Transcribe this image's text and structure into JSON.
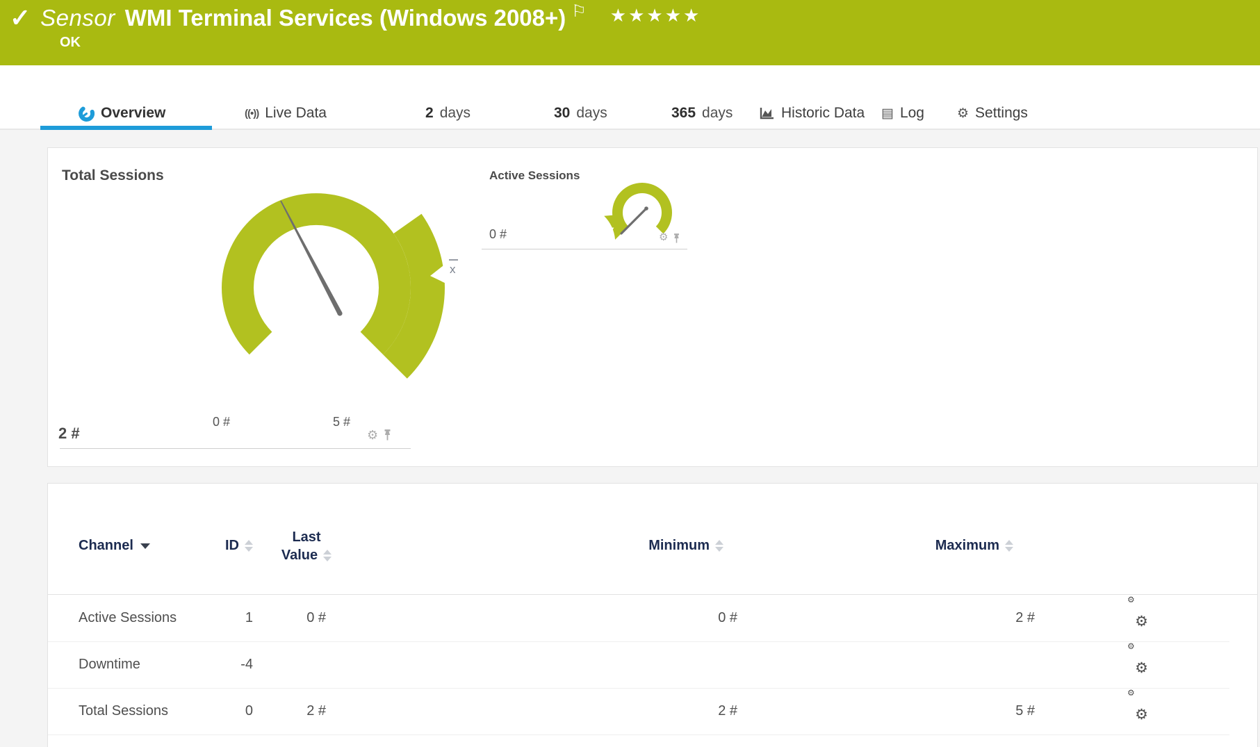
{
  "header": {
    "kind": "Sensor",
    "title": "WMI Terminal Services (Windows 2008+)",
    "status": "OK",
    "check_icon": "✓",
    "flag_icon": "⚐",
    "stars": "★★★★★",
    "bar_color": "#a9ba11"
  },
  "tabs": [
    {
      "label": "Overview",
      "icon": "gauge-icon",
      "active": true
    },
    {
      "label": "Live Data",
      "icon": "live-data-icon"
    },
    {
      "num": "2",
      "label": "days"
    },
    {
      "num": "30",
      "label": "days"
    },
    {
      "num": "365",
      "label": "days"
    },
    {
      "label": "Historic Data",
      "icon": "area-chart-icon"
    },
    {
      "label": "Log",
      "icon": "log-icon"
    },
    {
      "label": "Settings",
      "icon": "gear-icon"
    }
  ],
  "gauges": {
    "accent_color": "#b2c120",
    "needle_color": "#6e6e6e",
    "total": {
      "title": "Total Sessions",
      "value": "2 #",
      "min_label": "0 #",
      "max_label": "5 #",
      "avg_label": "x",
      "range_min": 0,
      "range_max": 5,
      "current": 2
    },
    "active": {
      "title": "Active Sessions",
      "value": "0 #",
      "range_min": 0,
      "current": 0
    }
  },
  "table": {
    "headers": {
      "channel": "Channel",
      "id": "ID",
      "last1": "Last",
      "last2": "Value",
      "minimum": "Minimum",
      "maximum": "Maximum"
    },
    "rows": [
      {
        "channel": "Active Sessions",
        "id": "1",
        "last": "0 #",
        "min": "0 #",
        "max": "2 #"
      },
      {
        "channel": "Downtime",
        "id": "-4",
        "last": "",
        "min": "",
        "max": ""
      },
      {
        "channel": "Total Sessions",
        "id": "0",
        "last": "2 #",
        "min": "2 #",
        "max": "5 #"
      }
    ]
  },
  "icons": {
    "gear": "⚙",
    "log": "▤"
  }
}
